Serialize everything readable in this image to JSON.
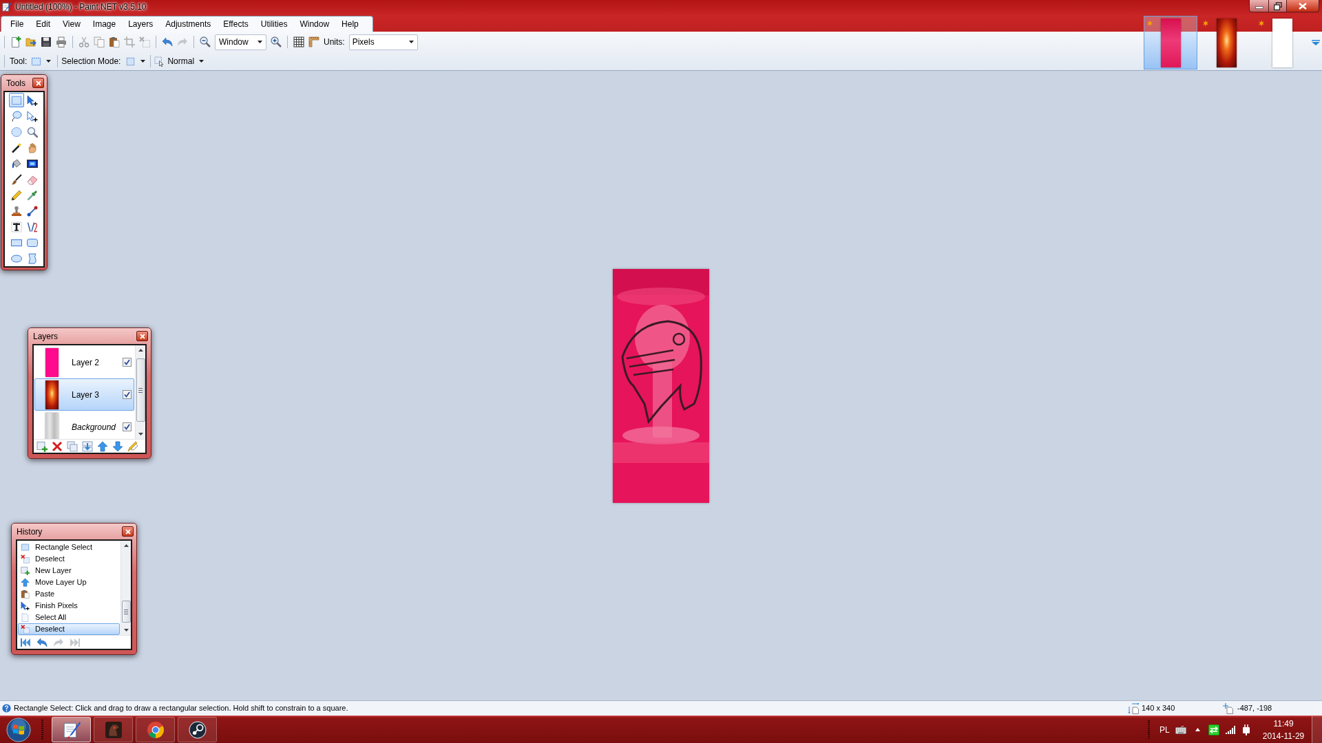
{
  "window": {
    "title": "Untitled (100%) - Paint.NET v3.5.10"
  },
  "menu": [
    "File",
    "Edit",
    "View",
    "Image",
    "Layers",
    "Adjustments",
    "Effects",
    "Utilities",
    "Window",
    "Help"
  ],
  "toolbar": {
    "zoom_mode": "Window",
    "units_label": "Units:",
    "units": "Pixels",
    "tool_label": "Tool:",
    "selection_mode_label": "Selection Mode:",
    "blend_mode": "Normal"
  },
  "image_tabs": [
    {
      "selected": true
    },
    {
      "selected": false
    },
    {
      "selected": false
    }
  ],
  "tools_panel": {
    "title": "Tools",
    "tools": [
      {
        "selected": true
      },
      {
        "selected": false
      },
      {
        "selected": false
      },
      {
        "selected": false
      },
      {
        "selected": false
      },
      {
        "selected": false
      },
      {
        "selected": false
      },
      {
        "selected": false
      },
      {
        "selected": false
      },
      {
        "selected": false
      },
      {
        "selected": false
      },
      {
        "selected": false
      },
      {
        "selected": false
      },
      {
        "selected": false
      },
      {
        "selected": false
      },
      {
        "selected": false
      },
      {
        "selected": false
      },
      {
        "selected": false
      },
      {
        "selected": false
      },
      {
        "selected": false
      },
      {
        "selected": false
      },
      {
        "selected": false
      }
    ]
  },
  "layers_panel": {
    "title": "Layers",
    "layers": [
      {
        "name": "Layer 2",
        "kind": "layer",
        "visible": true,
        "selected": false
      },
      {
        "name": "Layer 3",
        "kind": "layer",
        "visible": true,
        "selected": true
      },
      {
        "name": "Background",
        "kind": "background",
        "visible": true,
        "selected": false
      }
    ]
  },
  "history_panel": {
    "title": "History",
    "items": [
      {
        "label": "Rectangle Select",
        "selected": false
      },
      {
        "label": "Deselect",
        "selected": false
      },
      {
        "label": "New Layer",
        "selected": false
      },
      {
        "label": "Move Layer Up",
        "selected": false
      },
      {
        "label": "Paste",
        "selected": false
      },
      {
        "label": "Finish Pixels",
        "selected": false
      },
      {
        "label": "Select All",
        "selected": false
      },
      {
        "label": "Deselect",
        "selected": true
      }
    ]
  },
  "status_bar": {
    "hint": "Rectangle Select: Click and drag to draw a rectangular selection. Hold shift to constrain to a square.",
    "image_size": "140 x 340",
    "cursor_position": "-487, -198"
  },
  "taskbar": {
    "apps": [
      {
        "selected": true
      },
      {
        "selected": false
      },
      {
        "selected": false
      },
      {
        "selected": false
      }
    ],
    "language": "PL",
    "time": "11:49",
    "date": "2014-11-29"
  }
}
